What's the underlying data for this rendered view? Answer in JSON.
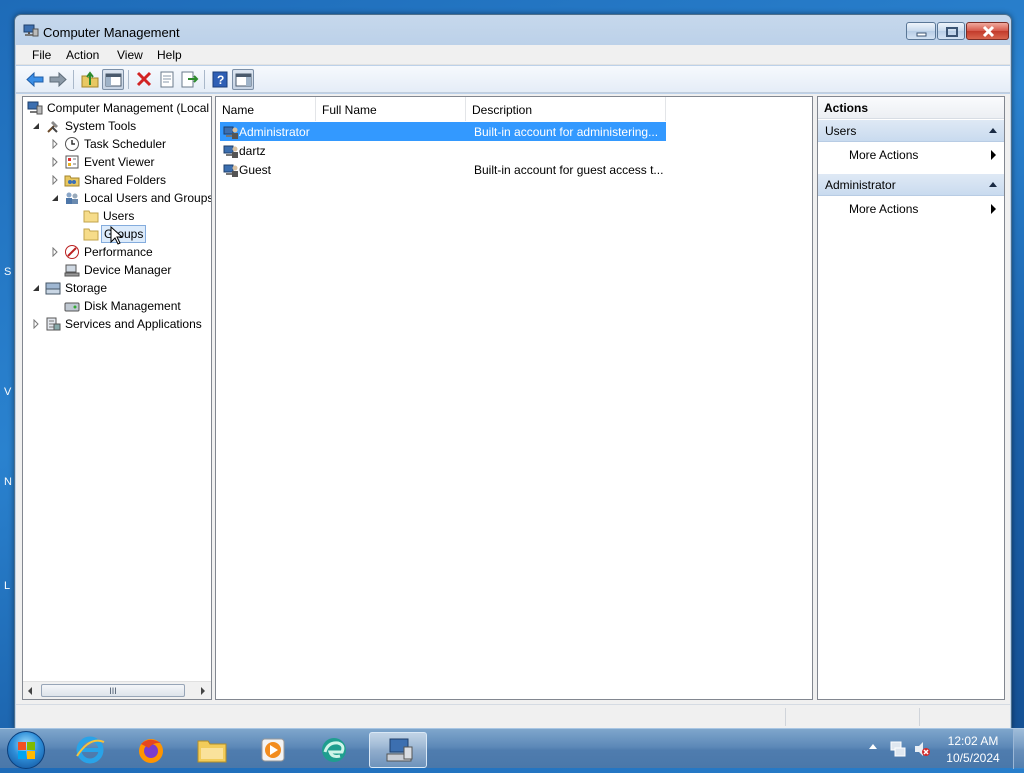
{
  "window": {
    "title": "Computer Management",
    "controls": {
      "minimize": "minimize",
      "maximize": "maximize",
      "close": "close"
    }
  },
  "menu": [
    "File",
    "Action",
    "View",
    "Help"
  ],
  "toolbar": {
    "buttons": [
      "back-icon",
      "forward-icon",
      "up-folder-icon",
      "show-hide-tree-icon",
      "delete-icon",
      "properties-icon",
      "export-list-icon",
      "help-icon",
      "show-hide-action-pane-icon"
    ]
  },
  "tree": {
    "root": "Computer Management (Local",
    "items": [
      {
        "label": "System Tools"
      },
      {
        "label": "Task Scheduler"
      },
      {
        "label": "Event Viewer"
      },
      {
        "label": "Shared Folders"
      },
      {
        "label": "Local Users and Groups"
      },
      {
        "label": "Users"
      },
      {
        "label": "Groups"
      },
      {
        "label": "Performance"
      },
      {
        "label": "Device Manager"
      },
      {
        "label": "Storage"
      },
      {
        "label": "Disk Management"
      },
      {
        "label": "Services and Applications"
      }
    ],
    "scroll_grip": "III"
  },
  "list": {
    "columns": [
      "Name",
      "Full Name",
      "Description"
    ],
    "rows": [
      {
        "name": "Administrator",
        "full_name": "",
        "description": "Built-in account for administering...",
        "selected": true
      },
      {
        "name": "dartz",
        "full_name": "",
        "description": "",
        "selected": false
      },
      {
        "name": "Guest",
        "full_name": "",
        "description": "Built-in account for guest access t...",
        "selected": false
      }
    ]
  },
  "actions": {
    "header": "Actions",
    "sections": [
      {
        "title": "Users",
        "item": "More Actions"
      },
      {
        "title": "Administrator",
        "item": "More Actions"
      }
    ]
  },
  "taskbar": {
    "apps": [
      "internet-explorer-icon",
      "firefox-icon",
      "file-explorer-icon",
      "media-player-icon",
      "edge-icon",
      "computer-management-icon"
    ],
    "clock": {
      "time": "12:02 AM",
      "date": "10/5/2024"
    }
  },
  "desktop_edge_letters": [
    "S",
    "V",
    "N",
    "L"
  ],
  "colors": {
    "selection": "#3399ff",
    "tree_selection": "#dcebfb",
    "section_header": "#c9dbef",
    "taskbar": "#5d89b8"
  }
}
